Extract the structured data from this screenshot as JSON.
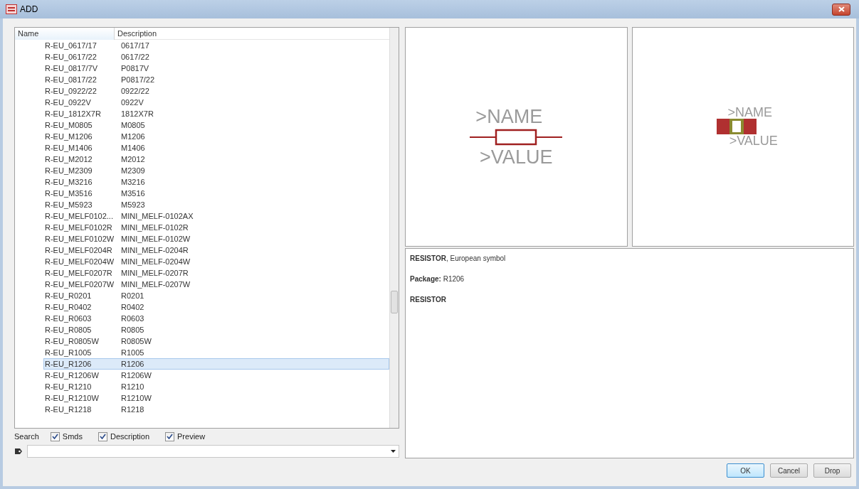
{
  "window": {
    "title": "ADD"
  },
  "table": {
    "columns": [
      "Name",
      "Description"
    ],
    "rows": [
      {
        "name": "R-EU_0617/17",
        "description": "0617/17",
        "selected": false
      },
      {
        "name": "R-EU_0617/22",
        "description": "0617/22",
        "selected": false
      },
      {
        "name": "R-EU_0817/7V",
        "description": "P0817V",
        "selected": false
      },
      {
        "name": "R-EU_0817/22",
        "description": "P0817/22",
        "selected": false
      },
      {
        "name": "R-EU_0922/22",
        "description": "0922/22",
        "selected": false
      },
      {
        "name": "R-EU_0922V",
        "description": "0922V",
        "selected": false
      },
      {
        "name": "R-EU_1812X7R",
        "description": "1812X7R",
        "selected": false
      },
      {
        "name": "R-EU_M0805",
        "description": "M0805",
        "selected": false
      },
      {
        "name": "R-EU_M1206",
        "description": "M1206",
        "selected": false
      },
      {
        "name": "R-EU_M1406",
        "description": "M1406",
        "selected": false
      },
      {
        "name": "R-EU_M2012",
        "description": "M2012",
        "selected": false
      },
      {
        "name": "R-EU_M2309",
        "description": "M2309",
        "selected": false
      },
      {
        "name": "R-EU_M3216",
        "description": "M3216",
        "selected": false
      },
      {
        "name": "R-EU_M3516",
        "description": "M3516",
        "selected": false
      },
      {
        "name": "R-EU_M5923",
        "description": "M5923",
        "selected": false
      },
      {
        "name": "R-EU_MELF0102...",
        "description": "MINI_MELF-0102AX",
        "selected": false
      },
      {
        "name": "R-EU_MELF0102R",
        "description": "MINI_MELF-0102R",
        "selected": false
      },
      {
        "name": "R-EU_MELF0102W",
        "description": "MINI_MELF-0102W",
        "selected": false
      },
      {
        "name": "R-EU_MELF0204R",
        "description": "MINI_MELF-0204R",
        "selected": false
      },
      {
        "name": "R-EU_MELF0204W",
        "description": "MINI_MELF-0204W",
        "selected": false
      },
      {
        "name": "R-EU_MELF0207R",
        "description": "MINI_MELF-0207R",
        "selected": false
      },
      {
        "name": "R-EU_MELF0207W",
        "description": "MINI_MELF-0207W",
        "selected": false
      },
      {
        "name": "R-EU_R0201",
        "description": "R0201",
        "selected": false
      },
      {
        "name": "R-EU_R0402",
        "description": "R0402",
        "selected": false
      },
      {
        "name": "R-EU_R0603",
        "description": "R0603",
        "selected": false
      },
      {
        "name": "R-EU_R0805",
        "description": "R0805",
        "selected": false
      },
      {
        "name": "R-EU_R0805W",
        "description": "R0805W",
        "selected": false
      },
      {
        "name": "R-EU_R1005",
        "description": "R1005",
        "selected": false
      },
      {
        "name": "R-EU_R1206",
        "description": "R1206",
        "selected": true
      },
      {
        "name": "R-EU_R1206W",
        "description": "R1206W",
        "selected": false
      },
      {
        "name": "R-EU_R1210",
        "description": "R1210",
        "selected": false
      },
      {
        "name": "R-EU_R1210W",
        "description": "R1210W",
        "selected": false
      },
      {
        "name": "R-EU_R1218",
        "description": "R1218",
        "selected": false
      }
    ]
  },
  "search": {
    "label": "Search",
    "options": [
      {
        "label": "Smds",
        "checked": true
      },
      {
        "label": "Description",
        "checked": true
      },
      {
        "label": "Preview",
        "checked": true
      }
    ]
  },
  "symbol_preview": {
    "name_label": ">NAME",
    "value_label": ">VALUE"
  },
  "package_preview": {
    "name_label": ">NAME",
    "value_label": ">VALUE"
  },
  "description": [
    "**RESISTOR**, European symbol",
    "**Package:** R1206",
    "**RESISTOR**"
  ],
  "buttons": [
    {
      "label": "OK",
      "default": true
    },
    {
      "label": "Cancel",
      "default": false
    },
    {
      "label": "Drop",
      "default": false
    }
  ]
}
